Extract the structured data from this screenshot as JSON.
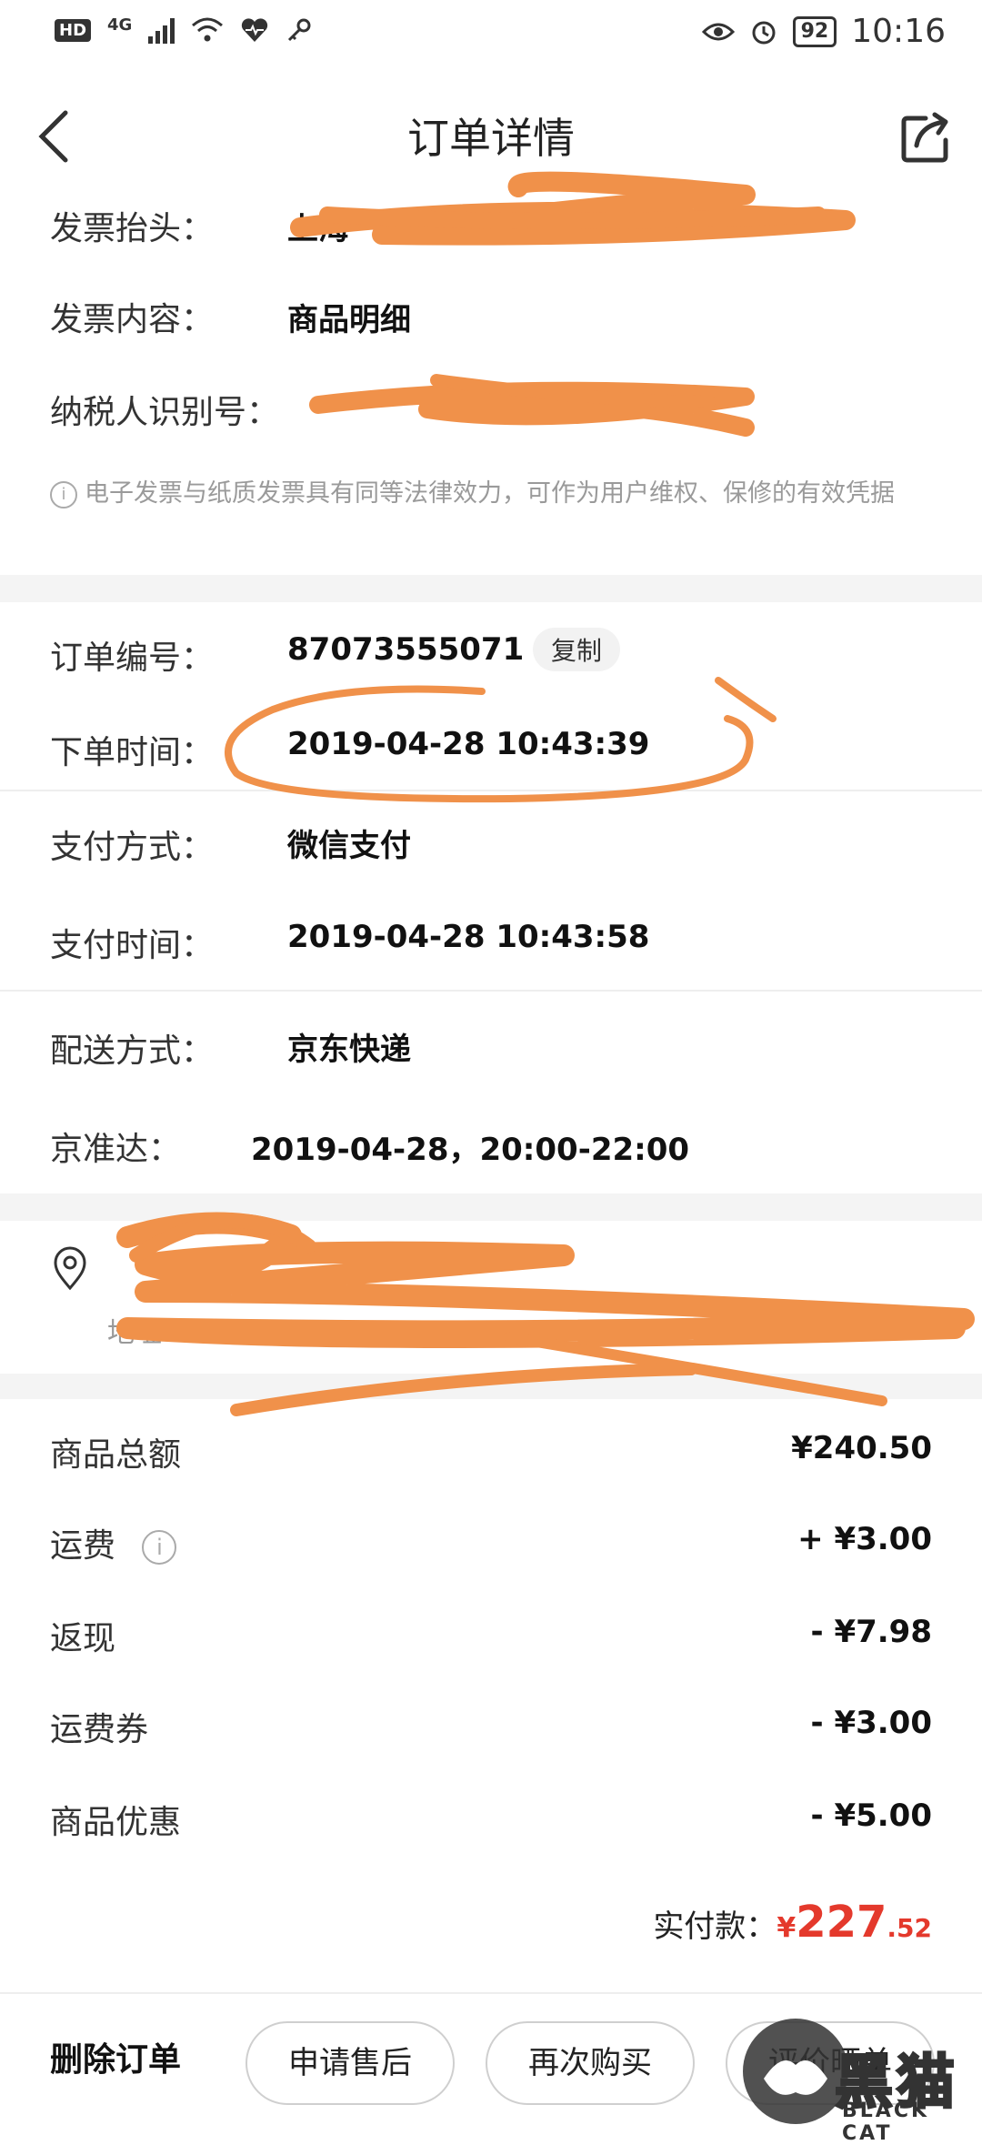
{
  "status_bar": {
    "hd": "HD",
    "network": "4G",
    "battery": "92",
    "time": "10:16"
  },
  "header": {
    "title": "订单详情"
  },
  "invoice": {
    "title_label": "发票抬头：",
    "title_value": "上海",
    "content_label": "发票内容：",
    "content_value": "商品明细",
    "tax_label": "纳税人识别号：",
    "note": "电子发票与纸质发票具有同等法律效力，可作为用户维权、保修的有效凭据"
  },
  "order": {
    "number_label": "订单编号：",
    "number_value": "87073555071",
    "copy_label": "复制",
    "time_label": "下单时间：",
    "time_value": "2019-04-28 10:43:39"
  },
  "payment": {
    "method_label": "支付方式：",
    "method_value": "微信支付",
    "time_label": "支付时间：",
    "time_value": "2019-04-28 10:43:58"
  },
  "delivery": {
    "method_label": "配送方式：",
    "method_value": "京东快递",
    "eta_label": "京准达：",
    "eta_value": "2019-04-28，20:00-22:00"
  },
  "address": {
    "line2_prefix": "地址"
  },
  "summary": {
    "items": [
      {
        "label": "商品总额",
        "value": "¥240.50"
      },
      {
        "label": "运费",
        "value": "+ ¥3.00"
      },
      {
        "label": "返现",
        "value": "- ¥7.98"
      },
      {
        "label": "运费券",
        "value": "- ¥3.00"
      },
      {
        "label": "商品优惠",
        "value": "- ¥5.00"
      }
    ],
    "actual_label": "实付款：",
    "actual_currency": "¥",
    "actual_int": "227",
    "actual_dec": ".52"
  },
  "actions": {
    "delete": "删除订单",
    "after_sale": "申请售后",
    "rebuy": "再次购买",
    "review": "评价晒单"
  },
  "watermark": {
    "text": "黑猫",
    "sub": "BLACK CAT"
  },
  "colors": {
    "accent_red": "#e4392c",
    "scribble_orange": "#f0914a"
  }
}
